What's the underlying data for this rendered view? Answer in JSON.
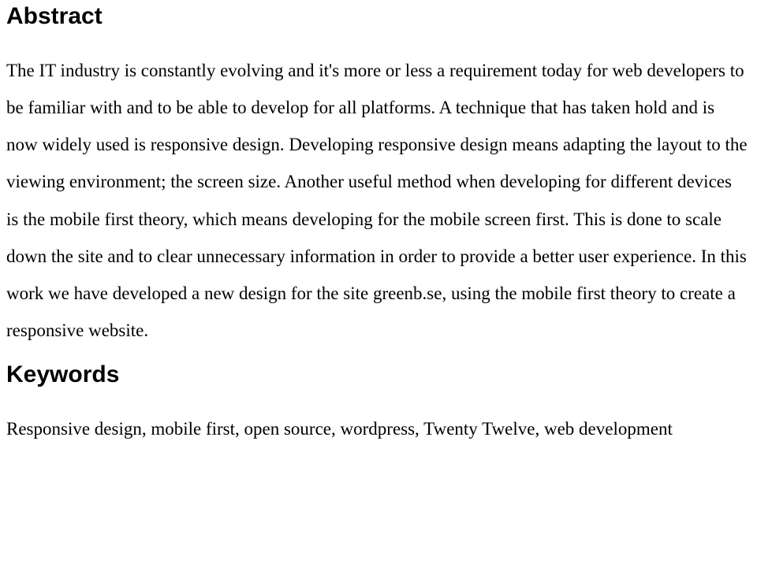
{
  "abstract": {
    "heading": "Abstract",
    "paragraph": "The IT industry is constantly evolving and it's more or less a requirement today for web developers to be familiar with and to be able to develop for all platforms. A technique that has taken hold and is now widely used is responsive design. Developing responsive design means adapting the layout to the viewing environment; the screen size. Another useful method when developing for different devices is the mobile first theory, which means developing for the mobile screen first. This is done to scale down the site and to clear unnecessary information in order to provide a better user experience. In this work we have developed a new design for the site greenb.se, using the mobile first theory to create a responsive website."
  },
  "keywords": {
    "heading": "Keywords",
    "paragraph": "Responsive design, mobile first, open source, wordpress, Twenty Twelve, web development"
  }
}
